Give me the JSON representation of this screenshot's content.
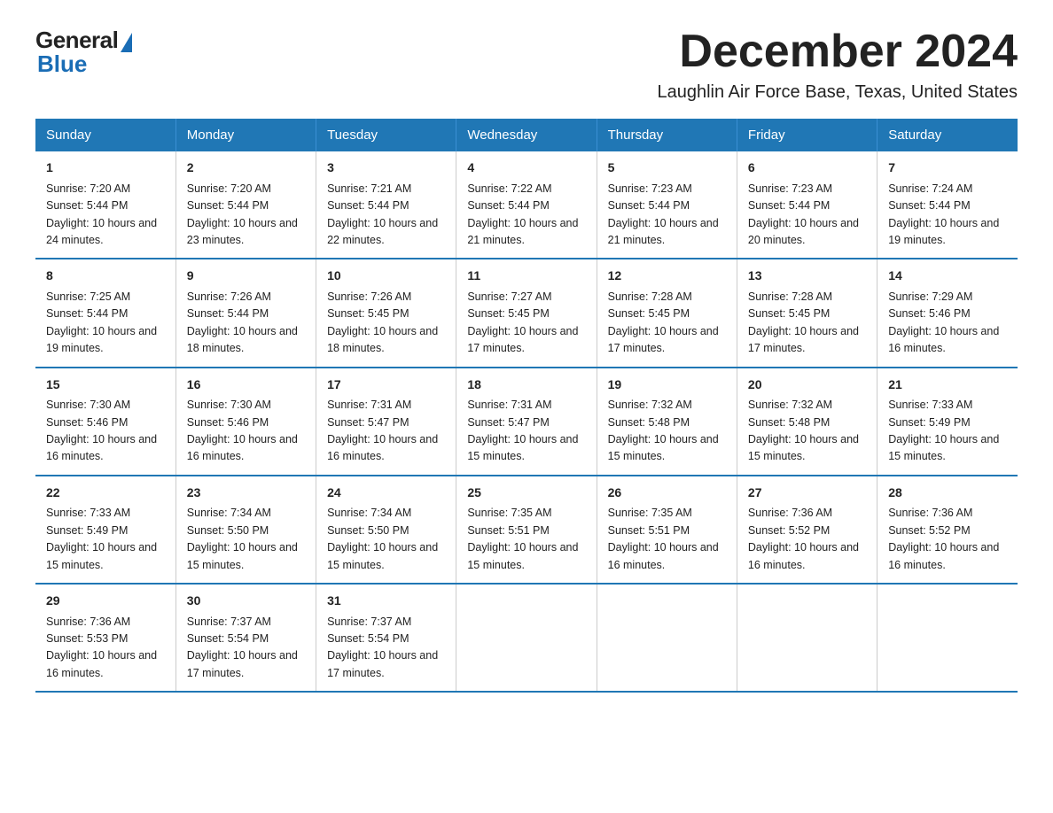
{
  "logo": {
    "general": "General",
    "blue": "Blue"
  },
  "header": {
    "month": "December 2024",
    "location": "Laughlin Air Force Base, Texas, United States"
  },
  "days_of_week": [
    "Sunday",
    "Monday",
    "Tuesday",
    "Wednesday",
    "Thursday",
    "Friday",
    "Saturday"
  ],
  "weeks": [
    [
      {
        "day": "1",
        "sunrise": "7:20 AM",
        "sunset": "5:44 PM",
        "daylight": "10 hours and 24 minutes."
      },
      {
        "day": "2",
        "sunrise": "7:20 AM",
        "sunset": "5:44 PM",
        "daylight": "10 hours and 23 minutes."
      },
      {
        "day": "3",
        "sunrise": "7:21 AM",
        "sunset": "5:44 PM",
        "daylight": "10 hours and 22 minutes."
      },
      {
        "day": "4",
        "sunrise": "7:22 AM",
        "sunset": "5:44 PM",
        "daylight": "10 hours and 21 minutes."
      },
      {
        "day": "5",
        "sunrise": "7:23 AM",
        "sunset": "5:44 PM",
        "daylight": "10 hours and 21 minutes."
      },
      {
        "day": "6",
        "sunrise": "7:23 AM",
        "sunset": "5:44 PM",
        "daylight": "10 hours and 20 minutes."
      },
      {
        "day": "7",
        "sunrise": "7:24 AM",
        "sunset": "5:44 PM",
        "daylight": "10 hours and 19 minutes."
      }
    ],
    [
      {
        "day": "8",
        "sunrise": "7:25 AM",
        "sunset": "5:44 PM",
        "daylight": "10 hours and 19 minutes."
      },
      {
        "day": "9",
        "sunrise": "7:26 AM",
        "sunset": "5:44 PM",
        "daylight": "10 hours and 18 minutes."
      },
      {
        "day": "10",
        "sunrise": "7:26 AM",
        "sunset": "5:45 PM",
        "daylight": "10 hours and 18 minutes."
      },
      {
        "day": "11",
        "sunrise": "7:27 AM",
        "sunset": "5:45 PM",
        "daylight": "10 hours and 17 minutes."
      },
      {
        "day": "12",
        "sunrise": "7:28 AM",
        "sunset": "5:45 PM",
        "daylight": "10 hours and 17 minutes."
      },
      {
        "day": "13",
        "sunrise": "7:28 AM",
        "sunset": "5:45 PM",
        "daylight": "10 hours and 17 minutes."
      },
      {
        "day": "14",
        "sunrise": "7:29 AM",
        "sunset": "5:46 PM",
        "daylight": "10 hours and 16 minutes."
      }
    ],
    [
      {
        "day": "15",
        "sunrise": "7:30 AM",
        "sunset": "5:46 PM",
        "daylight": "10 hours and 16 minutes."
      },
      {
        "day": "16",
        "sunrise": "7:30 AM",
        "sunset": "5:46 PM",
        "daylight": "10 hours and 16 minutes."
      },
      {
        "day": "17",
        "sunrise": "7:31 AM",
        "sunset": "5:47 PM",
        "daylight": "10 hours and 16 minutes."
      },
      {
        "day": "18",
        "sunrise": "7:31 AM",
        "sunset": "5:47 PM",
        "daylight": "10 hours and 15 minutes."
      },
      {
        "day": "19",
        "sunrise": "7:32 AM",
        "sunset": "5:48 PM",
        "daylight": "10 hours and 15 minutes."
      },
      {
        "day": "20",
        "sunrise": "7:32 AM",
        "sunset": "5:48 PM",
        "daylight": "10 hours and 15 minutes."
      },
      {
        "day": "21",
        "sunrise": "7:33 AM",
        "sunset": "5:49 PM",
        "daylight": "10 hours and 15 minutes."
      }
    ],
    [
      {
        "day": "22",
        "sunrise": "7:33 AM",
        "sunset": "5:49 PM",
        "daylight": "10 hours and 15 minutes."
      },
      {
        "day": "23",
        "sunrise": "7:34 AM",
        "sunset": "5:50 PM",
        "daylight": "10 hours and 15 minutes."
      },
      {
        "day": "24",
        "sunrise": "7:34 AM",
        "sunset": "5:50 PM",
        "daylight": "10 hours and 15 minutes."
      },
      {
        "day": "25",
        "sunrise": "7:35 AM",
        "sunset": "5:51 PM",
        "daylight": "10 hours and 15 minutes."
      },
      {
        "day": "26",
        "sunrise": "7:35 AM",
        "sunset": "5:51 PM",
        "daylight": "10 hours and 16 minutes."
      },
      {
        "day": "27",
        "sunrise": "7:36 AM",
        "sunset": "5:52 PM",
        "daylight": "10 hours and 16 minutes."
      },
      {
        "day": "28",
        "sunrise": "7:36 AM",
        "sunset": "5:52 PM",
        "daylight": "10 hours and 16 minutes."
      }
    ],
    [
      {
        "day": "29",
        "sunrise": "7:36 AM",
        "sunset": "5:53 PM",
        "daylight": "10 hours and 16 minutes."
      },
      {
        "day": "30",
        "sunrise": "7:37 AM",
        "sunset": "5:54 PM",
        "daylight": "10 hours and 17 minutes."
      },
      {
        "day": "31",
        "sunrise": "7:37 AM",
        "sunset": "5:54 PM",
        "daylight": "10 hours and 17 minutes."
      },
      null,
      null,
      null,
      null
    ]
  ]
}
